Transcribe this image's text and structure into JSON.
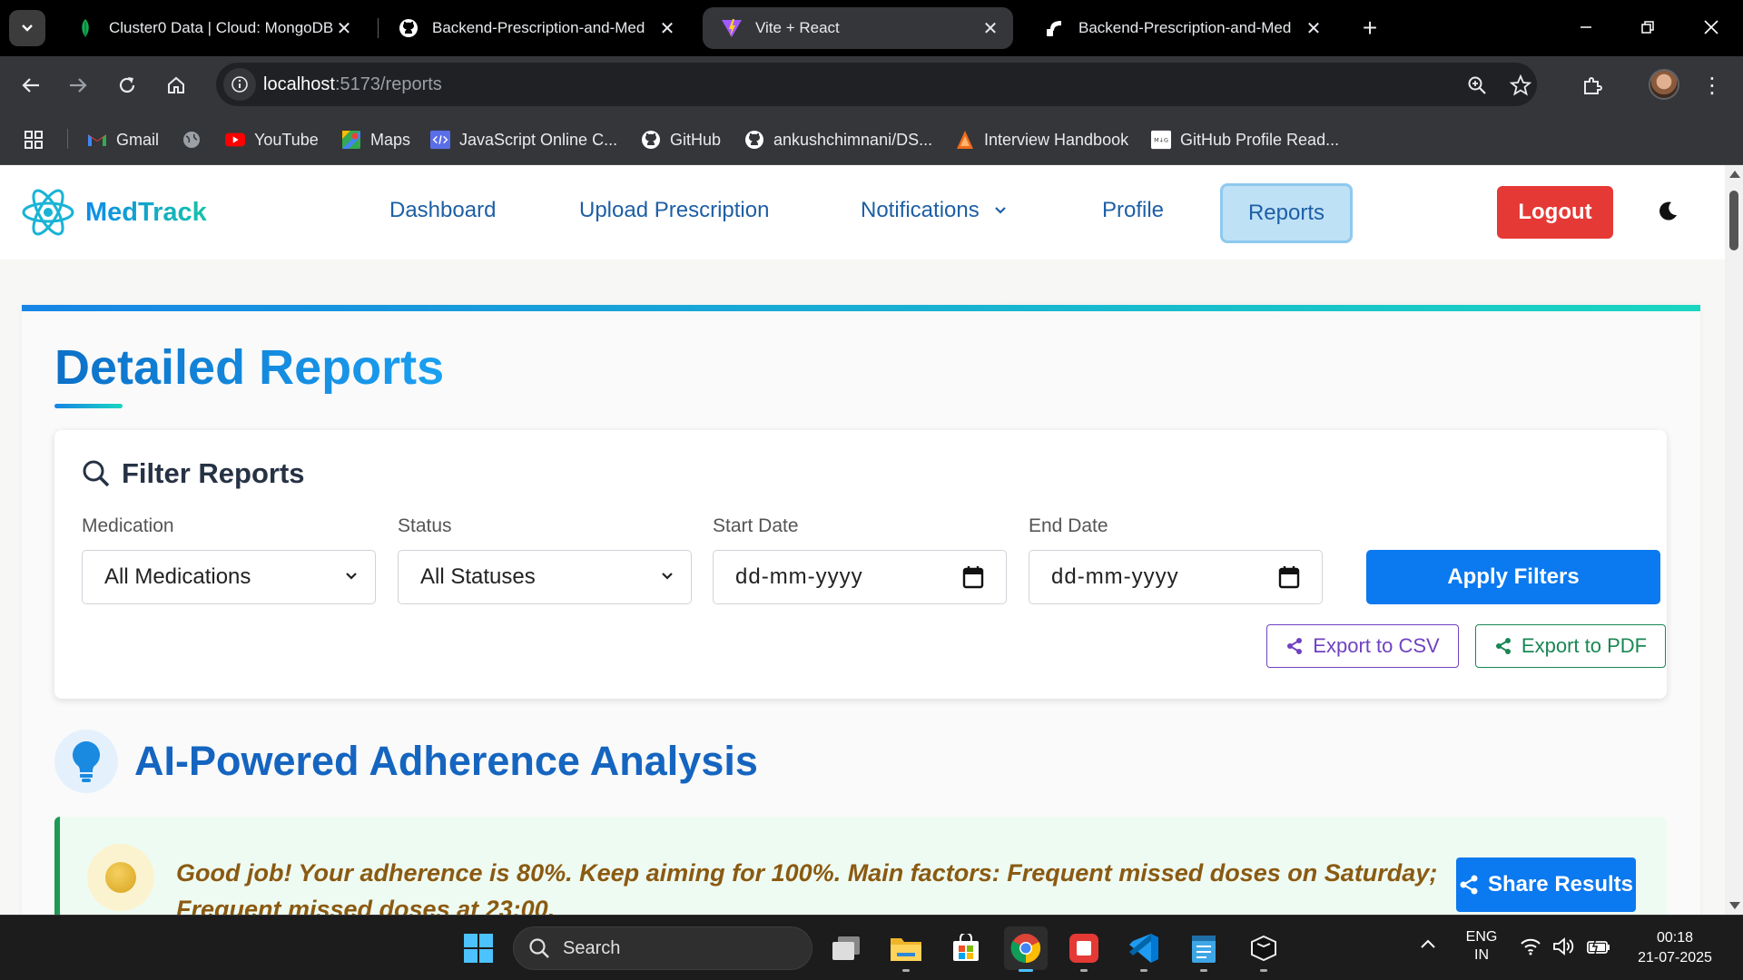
{
  "browser": {
    "tabs": [
      {
        "title": "Cluster0 Data | Cloud: MongoDB",
        "icon": "mongodb-leaf-icon",
        "active": false
      },
      {
        "title": "Backend-Prescription-and-Med",
        "icon": "github-icon",
        "active": false
      },
      {
        "title": "Vite + React",
        "icon": "vite-icon",
        "active": true
      },
      {
        "title": "Backend-Prescription-and-Med",
        "icon": "render-icon",
        "active": false
      }
    ],
    "url_host": "localhost",
    "url_path": ":5173/reports",
    "bookmarks": [
      {
        "label": "Gmail"
      },
      {
        "label": ""
      },
      {
        "label": "YouTube"
      },
      {
        "label": "Maps"
      },
      {
        "label": "JavaScript Online C..."
      },
      {
        "label": "GitHub"
      },
      {
        "label": "ankushchimnani/DS..."
      },
      {
        "label": "Interview Handbook"
      },
      {
        "label": "GitHub Profile Read..."
      }
    ]
  },
  "app": {
    "brand": "MedTrack",
    "nav": {
      "dashboard": "Dashboard",
      "upload": "Upload Prescription",
      "notifications": "Notifications",
      "profile": "Profile",
      "reports": "Reports",
      "logout": "Logout"
    },
    "page_title": "Detailed Reports",
    "filter": {
      "heading": "Filter Reports",
      "medication_label": "Medication",
      "medication_value": "All Medications",
      "status_label": "Status",
      "status_value": "All Statuses",
      "start_label": "Start Date",
      "start_placeholder": "dd-mm-yyyy",
      "end_label": "End Date",
      "end_placeholder": "dd-mm-yyyy",
      "apply": "Apply Filters",
      "export_csv": "Export to CSV",
      "export_pdf": "Export to PDF"
    },
    "ai": {
      "title": "AI-Powered Adherence Analysis",
      "insight": "Good job! Your adherence is 80%. Keep aiming for 100%. Main factors: Frequent missed doses on Saturday; Frequent missed doses at 23:00.",
      "share": "Share Results"
    },
    "colors": {
      "accent": "#0b79f0",
      "logout": "#e53935",
      "csv": "#6f42c1",
      "pdf": "#198754",
      "insight_text": "#8a5a12"
    }
  },
  "taskbar": {
    "search": "Search",
    "lang": "ENG",
    "region": "IN",
    "time": "00:18",
    "date": "21-07-2025"
  }
}
